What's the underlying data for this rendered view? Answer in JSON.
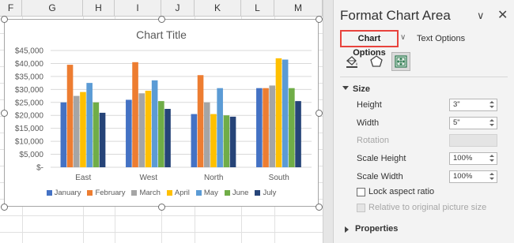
{
  "sheet": {
    "columns": [
      "F",
      "G",
      "H",
      "I",
      "J",
      "K",
      "L",
      "M"
    ]
  },
  "chart": {
    "title": "Chart Title",
    "y_axis": [
      "$45,000",
      "$40,000",
      "$35,000",
      "$30,000",
      "$25,000",
      "$20,000",
      "$15,000",
      "$10,000",
      "$5,000",
      "$-"
    ]
  },
  "chart_data": {
    "type": "bar",
    "title": "Chart Title",
    "categories": [
      "East",
      "West",
      "North",
      "South"
    ],
    "ylim": [
      0,
      45000
    ],
    "y_tick_step": 5000,
    "grid": true,
    "legend": "bottom",
    "series": [
      {
        "name": "January",
        "color": "#4472C4",
        "values": [
          25000,
          26000,
          20500,
          30500
        ]
      },
      {
        "name": "February",
        "color": "#ED7D31",
        "values": [
          39500,
          40500,
          35500,
          30500
        ]
      },
      {
        "name": "March",
        "color": "#A5A5A5",
        "values": [
          27500,
          28500,
          25000,
          31500
        ]
      },
      {
        "name": "April",
        "color": "#FFC000",
        "values": [
          29000,
          29500,
          20500,
          42000
        ]
      },
      {
        "name": "May",
        "color": "#5B9BD5",
        "values": [
          32500,
          33500,
          30500,
          41500
        ]
      },
      {
        "name": "June",
        "color": "#70AD47",
        "values": [
          25000,
          25500,
          20000,
          30500
        ]
      },
      {
        "name": "July",
        "color": "#264478",
        "values": [
          21000,
          22500,
          19500,
          25500
        ]
      }
    ]
  },
  "pane": {
    "title": "Format Chart Area",
    "dropdown_icon": "chevron-down-icon",
    "close_icon": "close-icon",
    "tabs": {
      "chart_options": "Chart Options",
      "text_options": "Text Options"
    },
    "icons": [
      "fill-line-icon",
      "effects-icon",
      "size-properties-icon"
    ],
    "size_section": "Size",
    "height_label": "Height",
    "height_value": "3\"",
    "width_label": "Width",
    "width_value": "5\"",
    "rotation_label": "Rotation",
    "scale_height_label": "Scale Height",
    "scale_height_value": "100%",
    "scale_width_label": "Scale Width",
    "scale_width_value": "100%",
    "lock_aspect_label": "Lock aspect ratio",
    "relative_label": "Relative to original picture size",
    "properties_section": "Properties"
  }
}
